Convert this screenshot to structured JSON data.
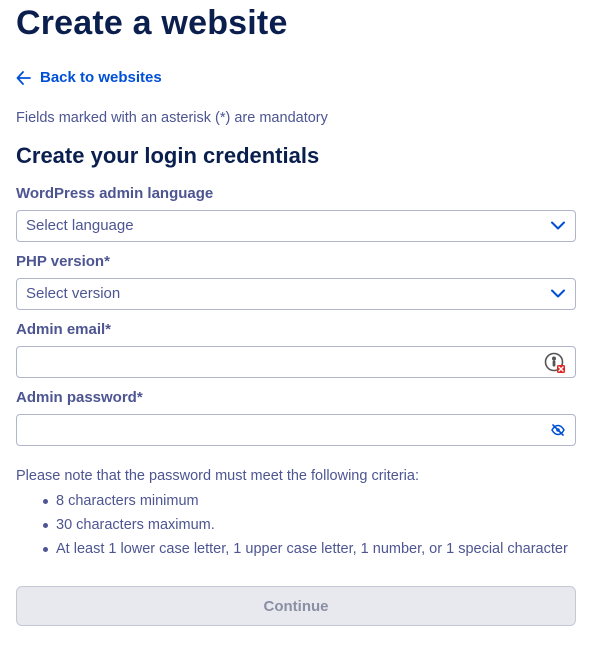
{
  "header": {
    "title": "Create a website"
  },
  "nav": {
    "back_label": "Back to websites"
  },
  "form": {
    "mandatory_note": "Fields marked with an asterisk (*) are mandatory",
    "section_title": "Create your login credentials",
    "language": {
      "label": "WordPress admin language",
      "value": "Select language"
    },
    "php": {
      "label": "PHP version*",
      "value": "Select version"
    },
    "email": {
      "label": "Admin email*",
      "value": ""
    },
    "password": {
      "label": "Admin password*",
      "value": ""
    },
    "criteria": {
      "intro": "Please note that the password must meet the following criteria:",
      "items": [
        "8 characters minimum",
        "30 characters maximum.",
        "At least 1 lower case letter, 1 upper case letter, 1 number, or 1 special character"
      ]
    },
    "continue_label": "Continue"
  },
  "icons": {
    "back": "arrow-left-icon",
    "select": "chevron-down-icon",
    "email_extension": "password-manager-icon",
    "password_toggle": "eye-slash-icon"
  },
  "colors": {
    "title": "#0b1f4f",
    "link": "#0050d7",
    "text": "#4d5592",
    "border": "#b0b6c9",
    "button_disabled_bg": "#e8e9ee",
    "button_disabled_text": "#8a8fa6"
  }
}
